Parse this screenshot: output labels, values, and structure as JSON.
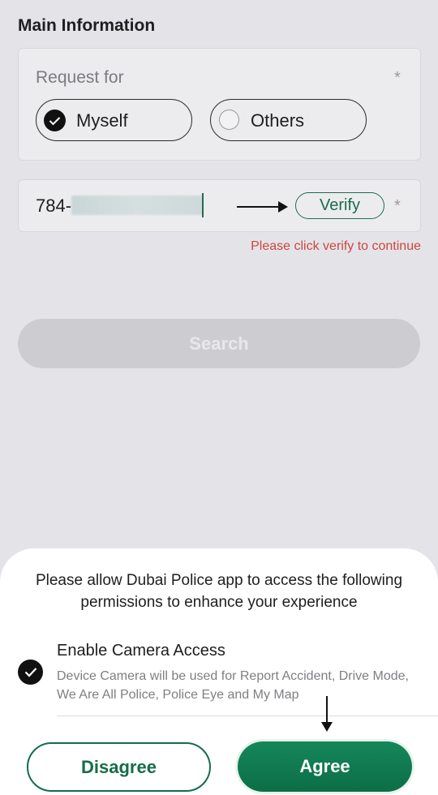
{
  "main": {
    "section_title": "Main Information",
    "request_for": {
      "label": "Request for",
      "required_mark": "*",
      "options": [
        {
          "label": "Myself",
          "selected": true
        },
        {
          "label": "Others",
          "selected": false
        }
      ]
    },
    "mobile": {
      "prefix": "784-",
      "required_mark": "*",
      "verify_label": "Verify",
      "error": "Please click verify to continue"
    },
    "search_label": "Search"
  },
  "permission_sheet": {
    "message": "Please allow Dubai Police app to access the following permissions to enhance your experience",
    "permission": {
      "title": "Enable Camera Access",
      "description": "Device Camera will be used for Report Accident, Drive Mode, We Are All Police, Police Eye and My Map",
      "checked": true
    },
    "disagree_label": "Disagree",
    "agree_label": "Agree"
  },
  "colors": {
    "accent": "#156c49",
    "error": "#d0453f",
    "background": "#e4e4e8"
  },
  "icons": {
    "selected_radio": "check-circle-icon",
    "unselected_radio": "empty-circle-icon",
    "verify_pointer": "arrow-right-icon",
    "agree_pointer": "arrow-down-icon"
  }
}
